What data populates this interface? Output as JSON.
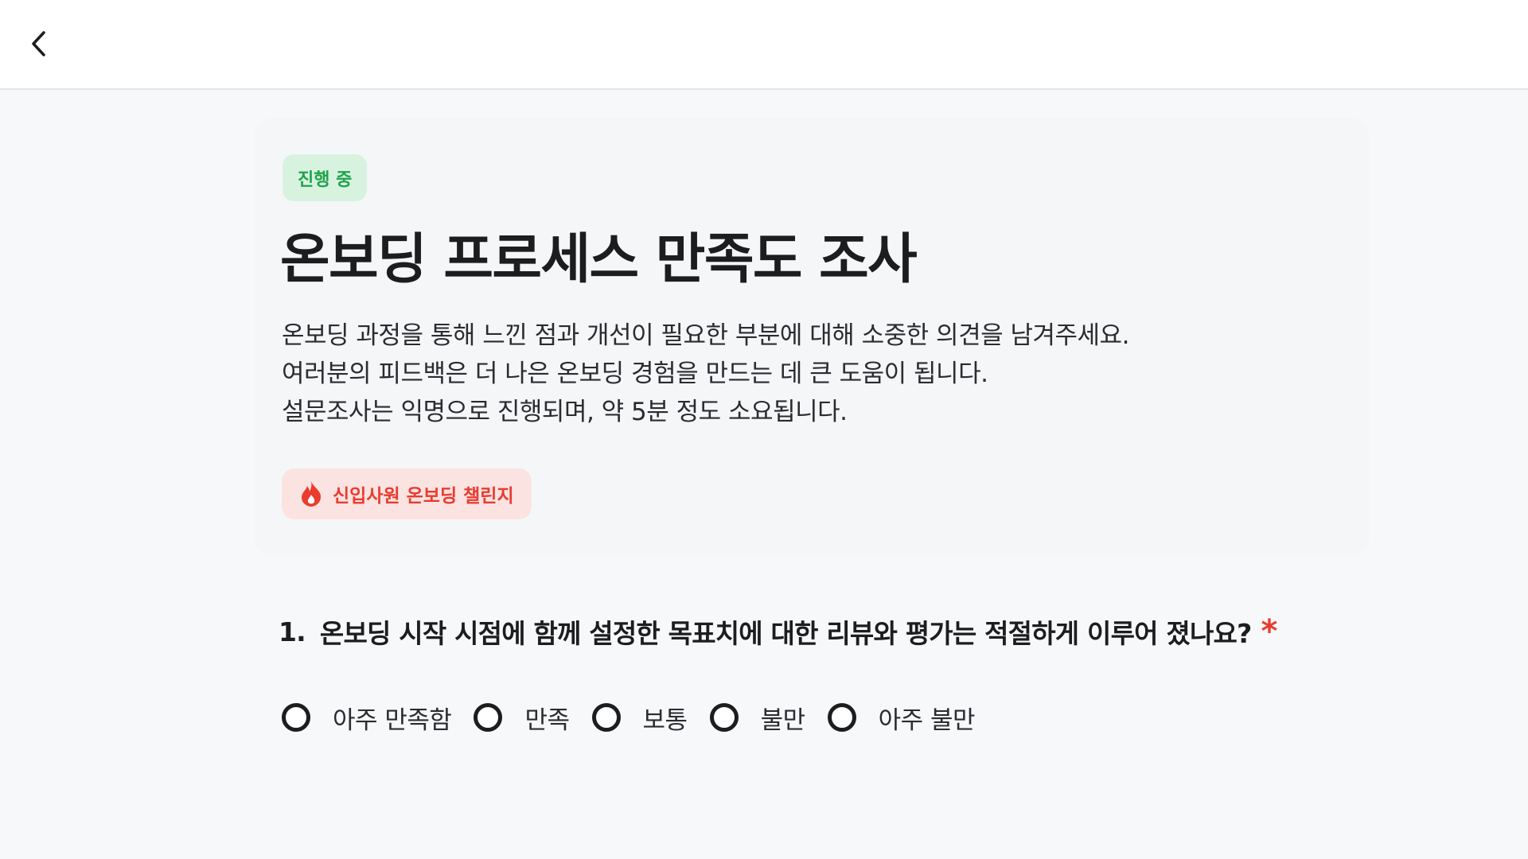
{
  "header": {
    "back_icon": "chevron-left-icon"
  },
  "survey": {
    "status": "진행 중",
    "title": "온보딩 프로세스 만족도 조사",
    "description": [
      "온보딩 과정을 통해 느낀 점과 개선이 필요한 부분에 대해 소중한 의견을 남겨주세요.",
      "여러분의 피드백은 더 나은 온보딩 경험을 만드는 데 큰 도움이 됩니다.",
      "설문조사는 익명으로 진행되며, 약 5분 정도 소요됩니다."
    ],
    "tag": {
      "icon": "fire-icon",
      "label": "신입사원 온보딩 챌린지"
    }
  },
  "question": {
    "number": "1.",
    "text": "온보딩 시작 시점에 함께 설정한 목표치에 대한 리뷰와 평가는 적절하게 이루어 졌나요?",
    "required_mark": "*",
    "options": [
      "아주 만족함",
      "만족",
      "보통",
      "불만",
      "아주 불만"
    ],
    "selected": null
  },
  "colors": {
    "background": "#f7f8fa",
    "status_bg": "#d7f3df",
    "status_text": "#1fa34a",
    "tag_bg": "#fbe3e2",
    "accent_red": "#ea3b2f"
  }
}
